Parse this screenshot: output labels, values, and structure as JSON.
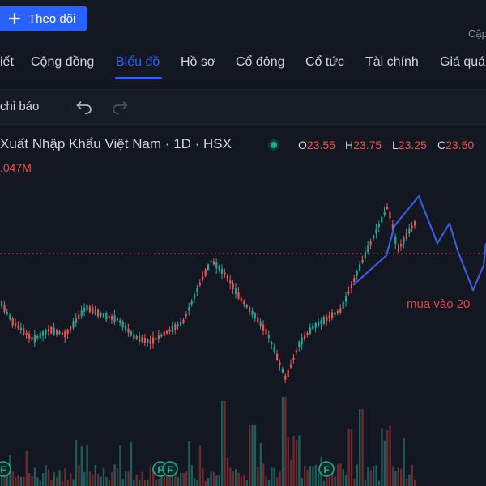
{
  "header": {
    "follow_label": "Theo dõi",
    "cap_text": "Cập"
  },
  "tabs": [
    {
      "label": "iết"
    },
    {
      "label": "Cộng đồng"
    },
    {
      "label": "Biểu đồ",
      "active": true
    },
    {
      "label": "Hồ sơ"
    },
    {
      "label": "Cổ đông"
    },
    {
      "label": "Cổ tức"
    },
    {
      "label": "Tài chính"
    },
    {
      "label": "Giá quá"
    }
  ],
  "toolbar": {
    "indicators_label": "chỉ báo"
  },
  "legend": {
    "title": "Xuất Nhập Khẩu Việt Nam · 1D · HSX",
    "open_key": "O",
    "open": "23.55",
    "high_key": "H",
    "high": "23.75",
    "low_key": "L",
    "low": "23.25",
    "close_key": "C",
    "close": "23.50",
    "volume": ".047M"
  },
  "annotation": {
    "text": "mua vào 20"
  },
  "colors": {
    "up": "#26a69a",
    "down": "#ef5350",
    "drawing": "#3b5bdb",
    "accent": "#2962ff",
    "background": "#131722"
  },
  "markers": [
    "F",
    "F",
    "F",
    "F"
  ],
  "chart_data": {
    "type": "candlestick",
    "symbol_label": "Xuất Nhập Khẩu Việt Nam · 1D · HSX",
    "last_ohlc": {
      "open": 23.55,
      "high": 23.75,
      "low": 23.25,
      "close": 23.5
    },
    "y_range": [
      15.5,
      25.0
    ],
    "price_line": 23.5,
    "close_path": [
      20.3,
      19.5,
      18.8,
      19.2,
      19.0,
      20.1,
      19.8,
      19.6,
      18.9,
      18.7,
      19.1,
      19.5,
      21.0,
      22.0,
      21.4,
      20.5,
      19.7,
      19.0,
      17.2,
      18.6,
      19.3,
      19.6,
      20.0,
      21.5,
      22.6,
      24.2,
      22.4,
      23.5
    ],
    "drawing_projection": [
      21.0,
      22.2,
      23.4,
      24.6,
      22.7,
      23.5,
      22.4,
      20.8,
      21.8,
      22.7
    ],
    "volume_spikes": [
      "mid",
      "high",
      "low"
    ]
  }
}
